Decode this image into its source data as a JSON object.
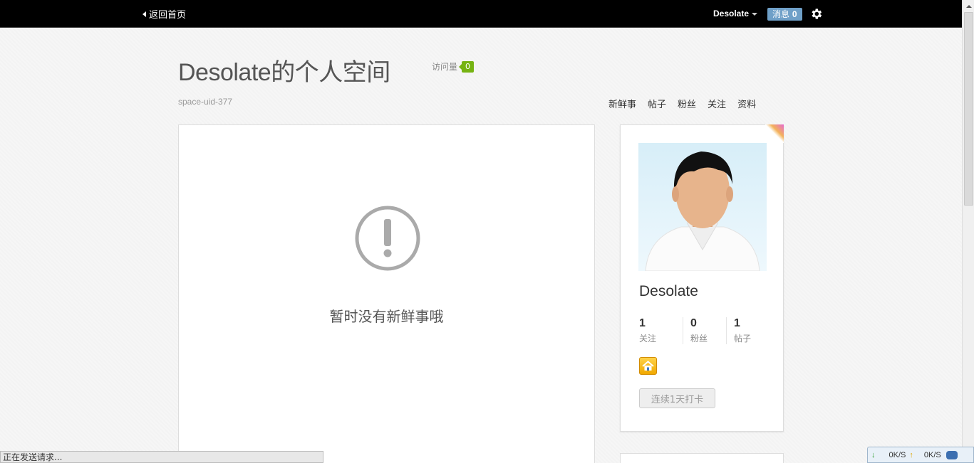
{
  "topbar": {
    "back_label": "返回首页",
    "username": "Desolate",
    "messages_label": "消息",
    "messages_count": "0"
  },
  "header": {
    "title": "Desolate的个人空间",
    "visits_label": "访问量",
    "visits_count": "0",
    "uid": "space-uid-377"
  },
  "space_nav": [
    "新鲜事",
    "帖子",
    "粉丝",
    "关注",
    "资料"
  ],
  "feed": {
    "empty_message": "暂时没有新鲜事哦",
    "icon": "alert-circle-icon"
  },
  "profile": {
    "name": "Desolate",
    "stats": [
      {
        "value": "1",
        "label": "关注"
      },
      {
        "value": "0",
        "label": "粉丝"
      },
      {
        "value": "1",
        "label": "帖子"
      }
    ],
    "badge_icon": "house-icon",
    "checkin_label": "连续1天打卡"
  },
  "browser": {
    "status_text": "正在发送请求...",
    "net_down": "0K/S",
    "net_up": "0K/S"
  },
  "colors": {
    "topbar_bg": "#000000",
    "message_badge": "#6fa0c8",
    "visit_badge": "#76b312",
    "badge_gold": "#f0a800"
  }
}
